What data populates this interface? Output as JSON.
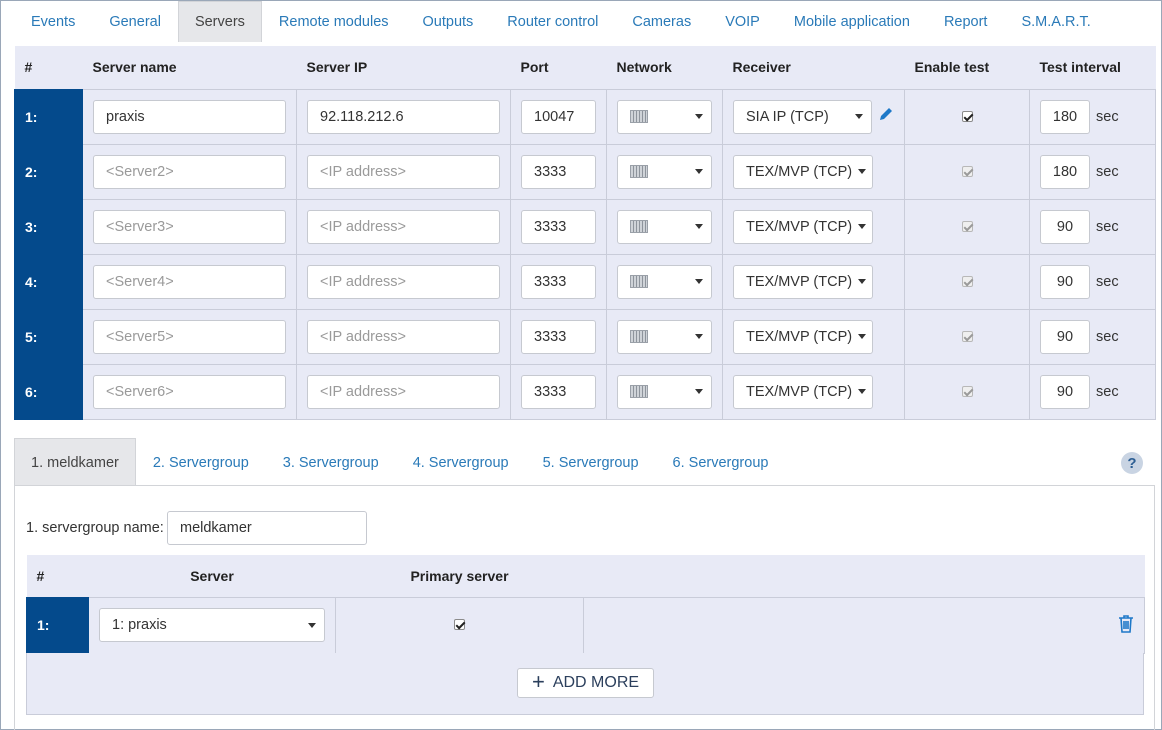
{
  "tabs": [
    "Events",
    "General",
    "Servers",
    "Remote modules",
    "Outputs",
    "Router control",
    "Cameras",
    "VOIP",
    "Mobile application",
    "Report",
    "S.M.A.R.T."
  ],
  "active_tab": "Servers",
  "servers_table": {
    "headers": {
      "num": "#",
      "name": "Server name",
      "ip": "Server IP",
      "port": "Port",
      "network": "Network",
      "receiver": "Receiver",
      "enable_test": "Enable test",
      "interval": "Test interval"
    },
    "unit": "sec",
    "rows": [
      {
        "num": "1:",
        "name": "praxis",
        "name_placeholder": "",
        "ip": "92.118.212.6",
        "ip_placeholder": "",
        "port": "10047",
        "receiver": "SIA IP (TCP)",
        "enable_test": true,
        "interval": "180"
      },
      {
        "num": "2:",
        "name": "",
        "name_placeholder": "<Server2>",
        "ip": "",
        "ip_placeholder": "<IP address>",
        "port": "3333",
        "receiver": "TEX/MVP (TCP)",
        "enable_test": true,
        "interval": "180"
      },
      {
        "num": "3:",
        "name": "",
        "name_placeholder": "<Server3>",
        "ip": "",
        "ip_placeholder": "<IP address>",
        "port": "3333",
        "receiver": "TEX/MVP (TCP)",
        "enable_test": true,
        "interval": "90"
      },
      {
        "num": "4:",
        "name": "",
        "name_placeholder": "<Server4>",
        "ip": "",
        "ip_placeholder": "<IP address>",
        "port": "3333",
        "receiver": "TEX/MVP (TCP)",
        "enable_test": true,
        "interval": "90"
      },
      {
        "num": "5:",
        "name": "",
        "name_placeholder": "<Server5>",
        "ip": "",
        "ip_placeholder": "<IP address>",
        "port": "3333",
        "receiver": "TEX/MVP (TCP)",
        "enable_test": true,
        "interval": "90"
      },
      {
        "num": "6:",
        "name": "",
        "name_placeholder": "<Server6>",
        "ip": "",
        "ip_placeholder": "<IP address>",
        "port": "3333",
        "receiver": "TEX/MVP (TCP)",
        "enable_test": true,
        "interval": "90"
      }
    ]
  },
  "group_tabs": [
    "1. meldkamer",
    "2. Servergroup",
    "3. Servergroup",
    "4. Servergroup",
    "5. Servergroup",
    "6. Servergroup"
  ],
  "active_group_tab": "1. meldkamer",
  "help_label": "?",
  "group_panel": {
    "name_label": "1. servergroup name:",
    "name_value": "meldkamer",
    "headers": {
      "num": "#",
      "server": "Server",
      "primary": "Primary server"
    },
    "rows": [
      {
        "num": "1:",
        "server": "1: praxis",
        "primary": true
      }
    ],
    "add_more_label": "ADD MORE"
  },
  "colors": {
    "accent": "#2a7ab8",
    "row_number_bg": "#044a8c",
    "table_bg": "#e8eaf6"
  }
}
